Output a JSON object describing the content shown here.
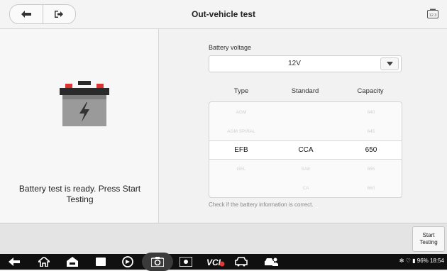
{
  "header": {
    "title": "Out-vehicle test",
    "back_icon": "back-arrow-icon",
    "exit_icon": "exit-icon",
    "right_icon": "report-badge-icon",
    "right_icon_text": "12.3"
  },
  "left_panel": {
    "battery_icon": "battery-icon",
    "status_text": "Battery test is ready. Press Start Testing"
  },
  "form": {
    "voltage_label": "Battery voltage",
    "voltage_value": "12V",
    "columns": [
      "Type",
      "Standard",
      "Capacity"
    ],
    "rows": [
      {
        "type": "AGM",
        "standard": "",
        "capacity": "640"
      },
      {
        "type": "AGM SPIRAL",
        "standard": "",
        "capacity": "645"
      },
      {
        "type": "EFB",
        "standard": "CCA",
        "capacity": "650"
      },
      {
        "type": "GEL",
        "standard": "SAE",
        "capacity": "655"
      },
      {
        "type": "",
        "standard": "CA",
        "capacity": "660"
      }
    ],
    "selected_row_index": 2,
    "hint": "Check if the battery information is correct."
  },
  "footer": {
    "start_button": "Start Testing"
  },
  "system_bar": {
    "icons": [
      "back-icon",
      "home-icon",
      "vci-home-icon",
      "recents-icon",
      "browser-icon",
      "camera-icon",
      "screen-capture-icon",
      "vci-icon",
      "car-icon",
      "car-user-icon"
    ],
    "status": "✻ ♡ ▮ 96% 18:54"
  }
}
